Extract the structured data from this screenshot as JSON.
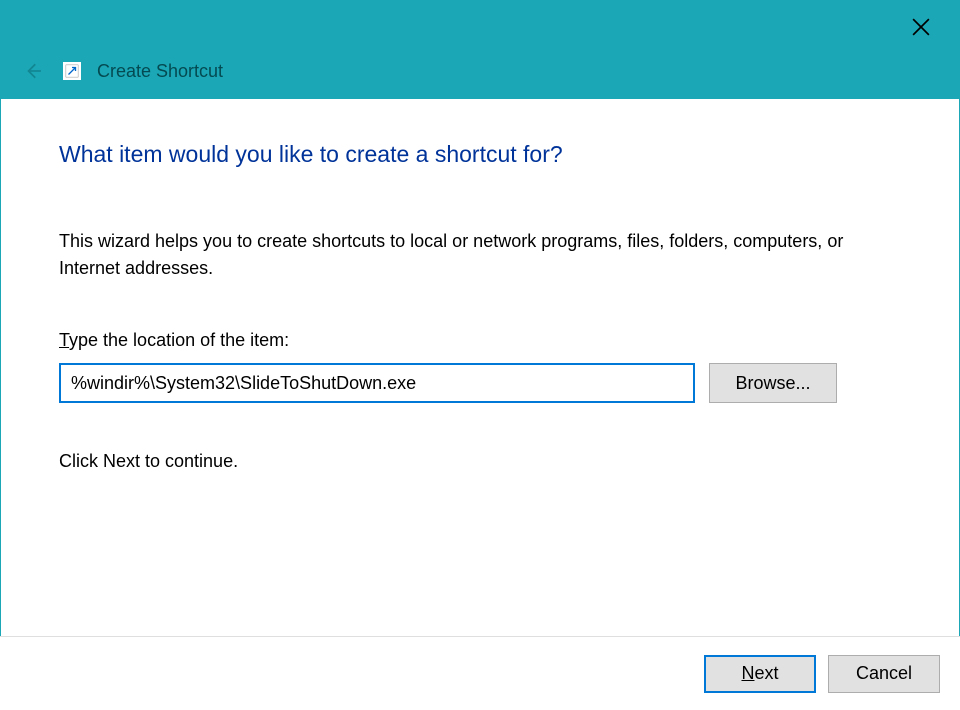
{
  "titlebar": {
    "title": "Create Shortcut"
  },
  "content": {
    "heading": "What item would you like to create a shortcut for?",
    "description": "This wizard helps you to create shortcuts to local or network programs, files, folders, computers, or Internet addresses.",
    "input_label_prefix": "T",
    "input_label_rest": "ype the location of the item:",
    "location_value": "%windir%\\System32\\SlideToShutDown.exe",
    "browse_label": "Browse...",
    "continue_text": "Click Next to continue."
  },
  "footer": {
    "next_underline": "N",
    "next_rest": "ext",
    "cancel_label": "Cancel"
  }
}
